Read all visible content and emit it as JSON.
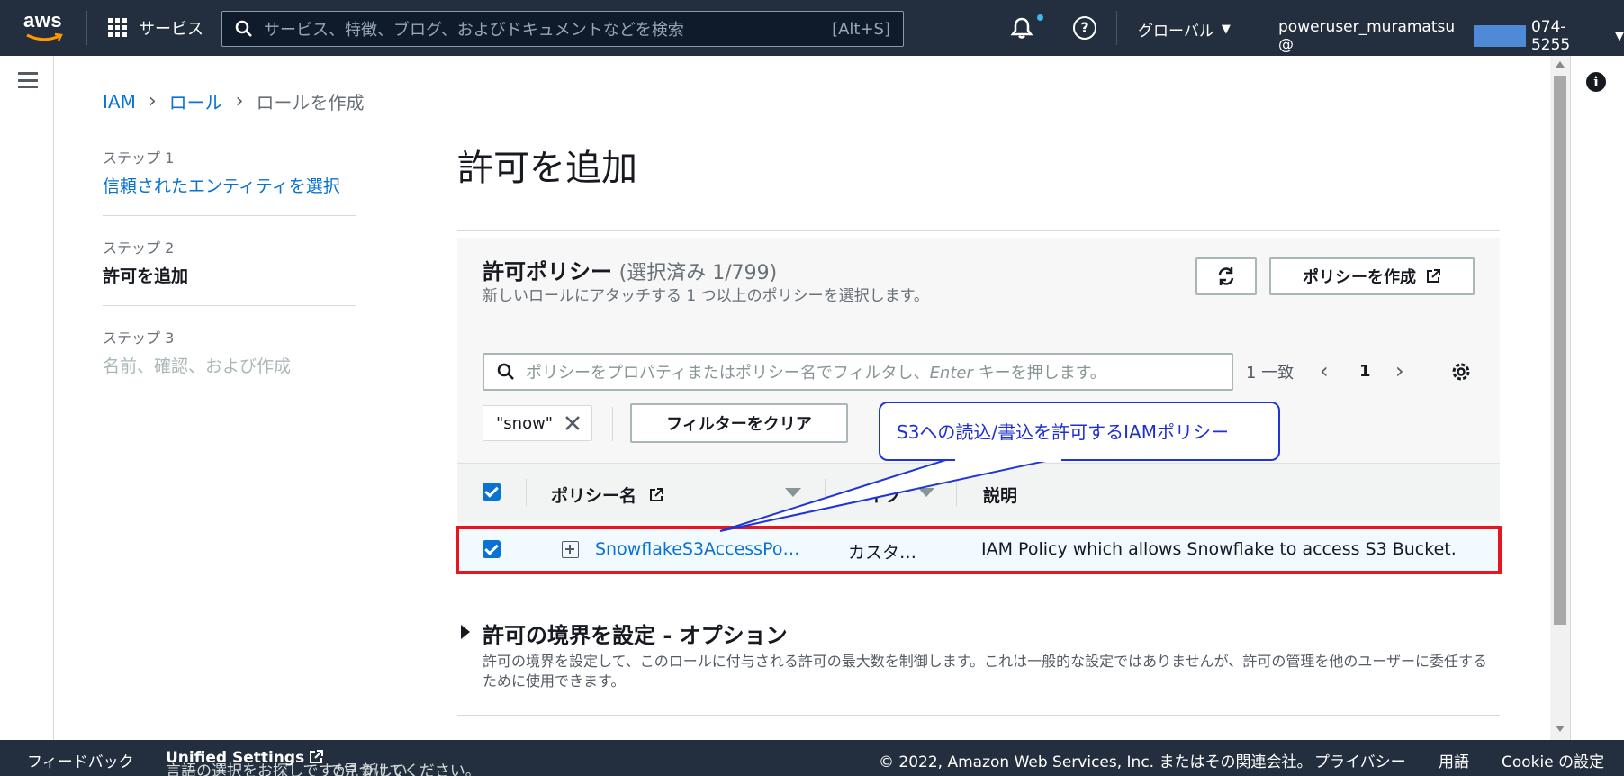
{
  "nav": {
    "logo_text": "aws",
    "services_label": "サービス",
    "search_placeholder": "サービス、特徴、ブログ、およびドキュメントなどを検索",
    "search_shortcut": "[Alt+S]",
    "region_label": "グローバル",
    "account_prefix": "poweruser_muramatsu @",
    "account_suffix": "074-5255"
  },
  "breadcrumb": {
    "iam": "IAM",
    "roles": "ロール",
    "current": "ロールを作成"
  },
  "steps": [
    {
      "number": "ステップ 1",
      "label": "信頼されたエンティティを選択"
    },
    {
      "number": "ステップ 2",
      "label": "許可を追加"
    },
    {
      "number": "ステップ 3",
      "label": "名前、確認、および作成"
    }
  ],
  "page_title": "許可を追加",
  "policies": {
    "heading": "許可ポリシー",
    "selected_count": "(選択済み 1/799)",
    "description": "新しいロールにアタッチする 1 つ以上のポリシーを選択します。",
    "create_button": "ポリシーを作成",
    "filter_placeholder_pre": "ポリシーをプロパティまたはポリシー名でフィルタし、",
    "filter_placeholder_key": "Enter",
    "filter_placeholder_post": " キーを押します。",
    "match_count": "1 一致",
    "page_number": "1",
    "filter_token": "\"snow\"",
    "clear_filters_button": "フィルターをクリア",
    "columns": {
      "name": "ポリシー名",
      "type": "タイプ",
      "description": "説明"
    },
    "rows": [
      {
        "name": "SnowflakeS3AccessPo…",
        "type": "カスタ…",
        "description": "IAM Policy which allows Snowflake to access S3 Bucket."
      }
    ]
  },
  "callout": "S3への読込/書込を許可するIAMポリシー",
  "boundary": {
    "title": "許可の境界を設定 - オプション",
    "description": "許可の境界を設定して、このロールに付与される許可の最大数を制御します。これは一般的な設定ではありませんが、許可の管理を他のユーザーに委任するために使用できます。"
  },
  "footer": {
    "feedback": "フィードバック",
    "language_prefix": "言語の選択をお探しですか? 新しい",
    "unified_settings": "Unified Settings",
    "language_suffix": "で見つけてください。",
    "copyright": "© 2022, Amazon Web Services, Inc. またはその関連会社。",
    "privacy": "プライバシー",
    "terms": "用語",
    "cookie": "Cookie の設定"
  },
  "colors": {
    "nav_bg": "#232f3e",
    "link": "#0972d3",
    "aws_orange": "#ff9900",
    "highlight_red": "#e8141e",
    "callout_blue": "#1f35d8"
  }
}
